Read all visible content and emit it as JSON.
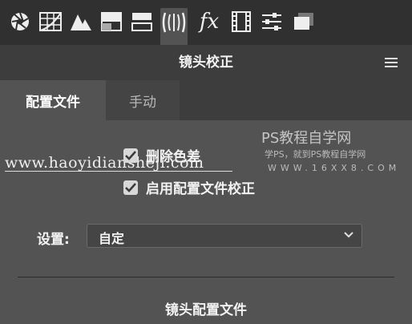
{
  "toolbar": {
    "icons": [
      "aperture-icon",
      "tone-curve-grid-icon",
      "mountains-icon",
      "split-toning-icon",
      "hsl-icon",
      "lens-correction-icon",
      "fx-icon",
      "film-strip-icon",
      "sliders-icon",
      "presets-stack-icon"
    ],
    "fx_label": "fx"
  },
  "panel": {
    "title": "镜头校正"
  },
  "tabs": [
    {
      "label": "配置文件",
      "active": true
    },
    {
      "label": "手动",
      "active": false
    }
  ],
  "options": {
    "remove_chromatic_aberration": {
      "label": "删除色差",
      "checked": true
    },
    "enable_profile_corrections": {
      "label": "启用配置文件校正",
      "checked": true
    }
  },
  "setting": {
    "label": "设置:",
    "value": "自定"
  },
  "section": {
    "title": "镜头配置文件"
  },
  "watermarks": {
    "left_url": "www.haoyidianshejì.com",
    "right_title": "PS教程自学网",
    "right_subtitle": "学PS，就到PS教程自学网",
    "right_url": "WWW.16XX8.COM"
  },
  "colors": {
    "panel_bg": "#535353",
    "toolbar_bg": "#303030",
    "header_bg": "#3d3d3d",
    "text": "#f2f2f2"
  }
}
